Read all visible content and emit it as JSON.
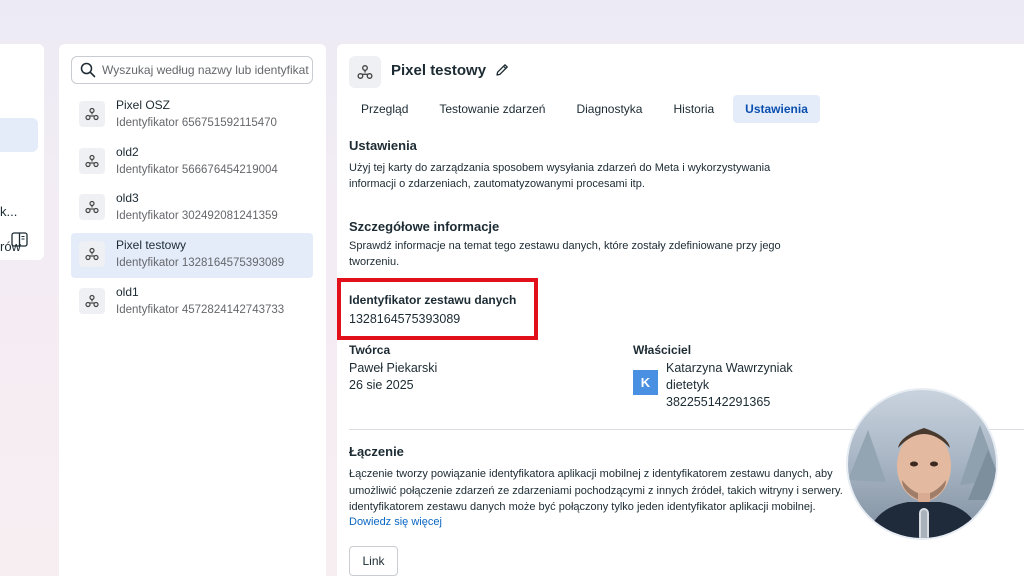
{
  "left_nav": {
    "partial_label_1": "k...",
    "partial_label_2": "rów",
    "panel_icon": "sidebar-panel-icon"
  },
  "datasets": {
    "search": {
      "placeholder": "Wyszukaj według nazwy lub identyfikat"
    },
    "items": [
      {
        "name": "Pixel OSZ",
        "id": "Identyfikator 656751592115470"
      },
      {
        "name": "old2",
        "id": "Identyfikator 566676454219004"
      },
      {
        "name": "old3",
        "id": "Identyfikator 302492081241359"
      },
      {
        "name": "Pixel testowy",
        "id": "Identyfikator 1328164575393089"
      },
      {
        "name": "old1",
        "id": "Identyfikator 4572824142743733"
      }
    ],
    "selected_index": 3
  },
  "main": {
    "title": "Pixel testowy",
    "tabs": [
      "Przegląd",
      "Testowanie zdarzeń",
      "Diagnostyka",
      "Historia",
      "Ustawienia"
    ],
    "active_tab": "Ustawienia",
    "settings": {
      "heading": "Ustawienia",
      "desc": "Użyj tej karty do zarządzania sposobem wysyłania zdarzeń do Meta i wykorzystywania informacji o zdarzeniach, zautomatyzowanymi procesami itp."
    },
    "details": {
      "heading": "Szczegółowe informacje",
      "desc": "Sprawdź informacje na temat tego zestawu danych, które zostały zdefiniowane przy jego tworzeniu."
    },
    "dataset_id": {
      "label": "Identyfikator zestawu danych",
      "value": "1328164575393089"
    },
    "creator": {
      "label": "Twórca",
      "name": "Paweł Piekarski",
      "date": "26 sie 2025"
    },
    "owner": {
      "label": "Właściciel",
      "initial": "K",
      "name": "Katarzyna Wawrzyniak",
      "role": "dietetyk",
      "id": "382255142291365"
    },
    "linking": {
      "heading": "Łączenie",
      "line1": "Łączenie tworzy powiązanie identyfikatora aplikacji mobilnej z identyfikatorem zestawu danych, aby",
      "line2": "umożliwić połączenie zdarzeń ze zdarzeniami pochodzącymi z innych źródeł, takich witryny i serwery.",
      "line3": "identyfikatorem zestawu danych może być połączony tylko jeden identyfikator aplikacji mobilnej.",
      "learn_more": "Dowiedz się więcej",
      "button": "Link"
    }
  },
  "colors": {
    "accent": "#0a4fad",
    "highlight_red": "#e1101a",
    "selected_bg": "#e4ecfa",
    "avatar": "#4a90e2"
  }
}
